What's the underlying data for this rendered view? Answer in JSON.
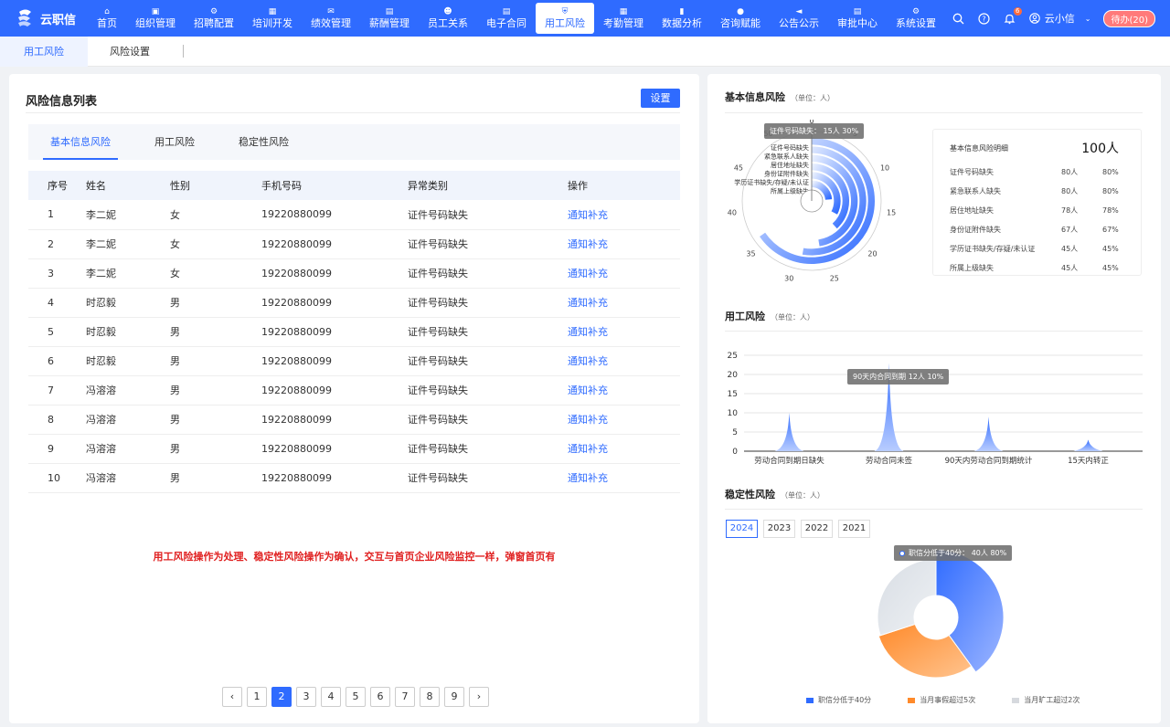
{
  "app": {
    "name": "云职信"
  },
  "nav": [
    {
      "label": "首页",
      "icon": "home-icon"
    },
    {
      "label": "组织管理",
      "icon": "org-icon"
    },
    {
      "label": "招聘配置",
      "icon": "recruit-icon"
    },
    {
      "label": "培训开发",
      "icon": "training-icon"
    },
    {
      "label": "绩效管理",
      "icon": "performance-icon"
    },
    {
      "label": "薪酬管理",
      "icon": "salary-icon"
    },
    {
      "label": "员工关系",
      "icon": "relations-icon"
    },
    {
      "label": "电子合同",
      "icon": "contract-icon"
    },
    {
      "label": "用工风险",
      "icon": "shield-icon"
    },
    {
      "label": "考勤管理",
      "icon": "attendance-icon"
    },
    {
      "label": "数据分析",
      "icon": "analytics-icon"
    },
    {
      "label": "咨询赋能",
      "icon": "consult-icon"
    },
    {
      "label": "公告公示",
      "icon": "announce-icon"
    },
    {
      "label": "审批中心",
      "icon": "approval-icon"
    },
    {
      "label": "系统设置",
      "icon": "gear-icon"
    }
  ],
  "header": {
    "bell_count": "6",
    "user_name": "云小信",
    "todo_label": "待办(20)"
  },
  "subtabs": [
    "用工风险",
    "风险设置"
  ],
  "left": {
    "title": "风险信息列表",
    "settings_label": "设置",
    "tabs": [
      "基本信息风险",
      "用工风险",
      "稳定性风险"
    ],
    "columns": [
      "序号",
      "姓名",
      "性别",
      "手机号码",
      "异常类别",
      "操作"
    ],
    "rows": [
      [
        "1",
        "李二妮",
        "女",
        "19220880099",
        "证件号码缺失",
        "通知补充"
      ],
      [
        "2",
        "李二妮",
        "女",
        "19220880099",
        "证件号码缺失",
        "通知补充"
      ],
      [
        "3",
        "李二妮",
        "女",
        "19220880099",
        "证件号码缺失",
        "通知补充"
      ],
      [
        "4",
        "时忍毅",
        "男",
        "19220880099",
        "证件号码缺失",
        "通知补充"
      ],
      [
        "5",
        "时忍毅",
        "男",
        "19220880099",
        "证件号码缺失",
        "通知补充"
      ],
      [
        "6",
        "时忍毅",
        "男",
        "19220880099",
        "证件号码缺失",
        "通知补充"
      ],
      [
        "7",
        "冯溶溶",
        "男",
        "19220880099",
        "证件号码缺失",
        "通知补充"
      ],
      [
        "8",
        "冯溶溶",
        "男",
        "19220880099",
        "证件号码缺失",
        "通知补充"
      ],
      [
        "9",
        "冯溶溶",
        "男",
        "19220880099",
        "证件号码缺失",
        "通知补充"
      ],
      [
        "10",
        "冯溶溶",
        "男",
        "19220880099",
        "证件号码缺失",
        "通知补充"
      ]
    ],
    "notice": "用工风险操作为处理、稳定性风险操作为确认，交互与首页企业风险监控一样，弹窗首页有",
    "pages": [
      "1",
      "2",
      "3",
      "4",
      "5",
      "6",
      "7",
      "8",
      "9"
    ],
    "current_page": "2"
  },
  "basic_risk": {
    "title": "基本信息风险",
    "unit": "（单位：人）",
    "tooltip": "证件号码缺失：  15人  30%",
    "box_title": "基本信息风险明细",
    "total": "100人",
    "items": [
      {
        "name": "证件号码缺失",
        "count": "80人",
        "pct": "80%"
      },
      {
        "name": "紧急联系人缺失",
        "count": "80人",
        "pct": "80%"
      },
      {
        "name": "居住地址缺失",
        "count": "78人",
        "pct": "78%"
      },
      {
        "name": "身份证附件缺失",
        "count": "67人",
        "pct": "67%"
      },
      {
        "name": "学历证书缺失/存疑/未认证",
        "count": "45人",
        "pct": "45%"
      },
      {
        "name": "所属上级缺失",
        "count": "45人",
        "pct": "45%"
      }
    ]
  },
  "chart_data": [
    {
      "type": "radial-bar",
      "title": "基本信息风险",
      "angle_ticks": [
        "0",
        "5",
        "10",
        "15",
        "20",
        "25",
        "30",
        "35",
        "40",
        "45",
        "50"
      ],
      "angle_max": 55,
      "categories": [
        "证件号码缺失",
        "紧急联系人缺失",
        "居住地址缺失",
        "身份证附件缺失",
        "学历证书缺失/存疑/未认证",
        "所属上级缺失"
      ],
      "values": [
        36,
        29,
        26,
        21,
        18,
        13
      ],
      "highlight": {
        "category": "证件号码缺失",
        "count": 15,
        "pct": "30%"
      }
    },
    {
      "type": "area",
      "title": "用工风险",
      "unit": "（单位：人）",
      "categories": [
        "劳动合同到期日缺失",
        "劳动合同未签",
        "90天内劳动合同到期统计",
        "15天内转正"
      ],
      "values": [
        10,
        23,
        9,
        3
      ],
      "ylim": [
        0,
        25
      ],
      "yticks": [
        0,
        5,
        10,
        15,
        20,
        25
      ],
      "tooltip": "90天内合同到期   12人  10%",
      "colors": {
        "line": "#2f6bff"
      }
    },
    {
      "type": "pie",
      "title": "稳定性风险",
      "unit": "（单位：人）",
      "years": [
        "2024",
        "2023",
        "2022",
        "2021"
      ],
      "selected_year": "2024",
      "series": [
        {
          "name": "职信分低于40分",
          "value": 40,
          "color": "#2f6bff"
        },
        {
          "name": "当月事假超过5次",
          "value": 30,
          "color": "#ff8a2a"
        },
        {
          "name": "当月旷工超过2次",
          "value": 30,
          "color": "#d8dde4"
        }
      ],
      "tooltip": "职信分低于40分：  40人   80%"
    }
  ]
}
